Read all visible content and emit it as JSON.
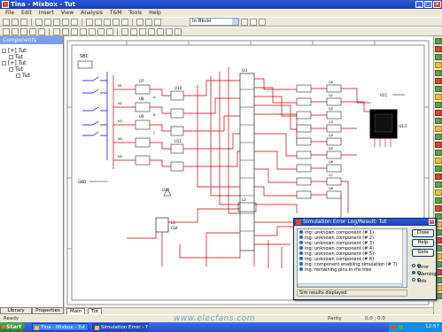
{
  "window": {
    "title": "Tina - Mixbox - Tut"
  },
  "menu": [
    "File",
    "Edit",
    "Insert",
    "View",
    "Analysis",
    "T&M",
    "Tools",
    "Help"
  ],
  "toolbar": {
    "component_combo": "In Bkcki"
  },
  "left_panel": {
    "header": "Components",
    "tree": [
      {
        "label": "[+] Tut",
        "level": 0
      },
      {
        "label": "Tut",
        "level": 1
      },
      {
        "label": "[+] Tut",
        "level": 0
      },
      {
        "label": "Tut",
        "level": 1
      },
      {
        "label": "Tut",
        "level": 2
      }
    ],
    "tab_left": "Library",
    "tab_right": "Properties"
  },
  "schematic": {
    "labels": {
      "top_left_block": "SBC",
      "u7": "U7",
      "u8": "U8",
      "u9": "U9",
      "u10": "U10",
      "u11": "U11",
      "u12": "U12",
      "u3": "U3",
      "gnd": "GND",
      "clk": "CLK",
      "vcc1": "VCC",
      "vcc2": "VCC",
      "chip": "U13",
      "l1": "L1",
      "l2": "L2"
    },
    "bank_labels": [
      "Q0",
      "Q1",
      "Q2",
      "Q3",
      "Q4",
      "Q5",
      "Q6",
      "Q7",
      "Q8",
      "Q9",
      "Q10",
      "Q11"
    ]
  },
  "dialog": {
    "title": "Simulation Error Log/Result: Tut",
    "log_lines": [
      "ing: unknown component (# 1)",
      "ing: unknown component (# 2)",
      "ing: unknown component (# 3)",
      "ing: unknown component (# 4)",
      "ing: unknown component (# 5)",
      "ing: unknown component (# 6)",
      "ing: component enabling simulation (# 7)",
      "ing: remaining pins in rhs tree"
    ],
    "status": "Sim results displayed",
    "buttons": [
      "Close",
      "Help",
      "Goto"
    ],
    "radios": [
      {
        "label": "Error",
        "on": false
      },
      {
        "label": "Warning",
        "on": true
      },
      {
        "label": "Info",
        "on": false
      }
    ]
  },
  "sheet_tabs": [
    "Main",
    "Tut"
  ],
  "statusbar": {
    "left": "Ready",
    "mid": "Parity",
    "coords": "0.0 ; 0.0"
  },
  "watermark": "www.elecfans.com",
  "taskbar": {
    "start": "Start",
    "tasks": [
      "Tina - Mixbox - Tut",
      "Simulation Error - Tut"
    ],
    "time": "12:57"
  },
  "colors": {
    "wire_red": "#cc0000",
    "wire_blue": "#0000cc",
    "chip_black": "#000000",
    "accent": "#2a5bd7"
  }
}
